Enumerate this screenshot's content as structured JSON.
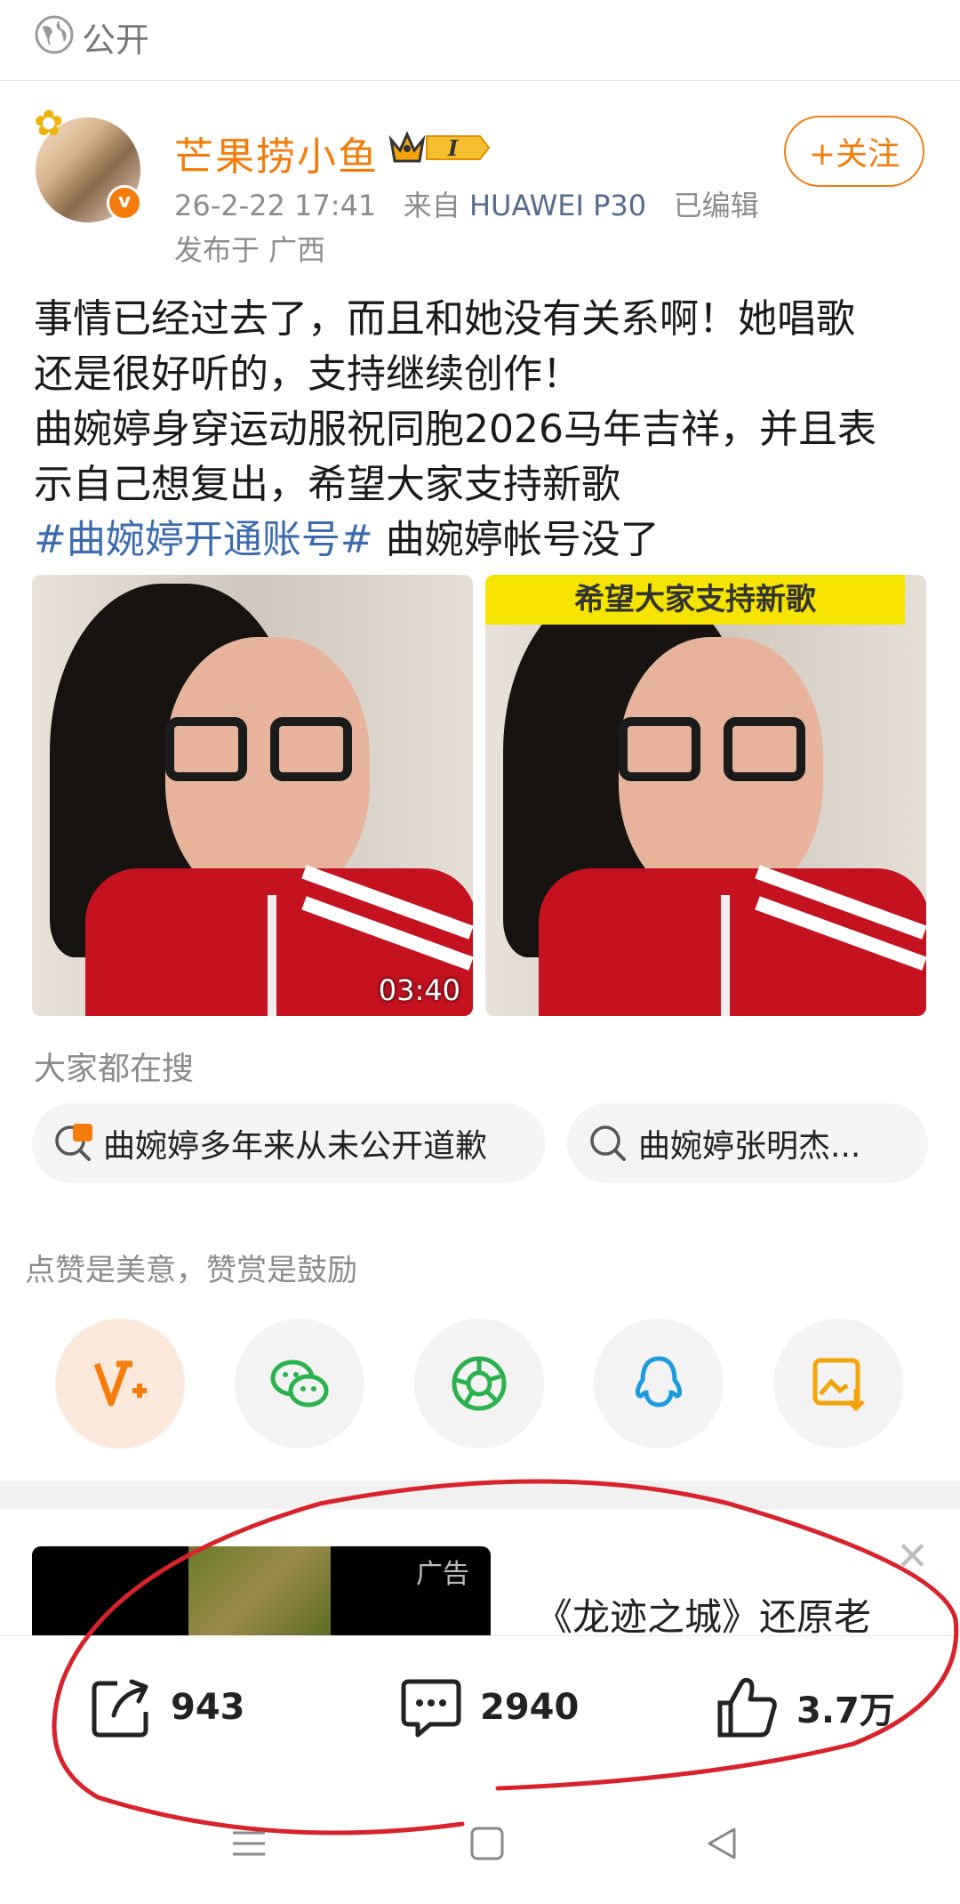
{
  "visibility": {
    "label": "公开",
    "icon": "globe-icon"
  },
  "post": {
    "username": "芒果捞小鱼",
    "level_badge": "I",
    "meta_time": "26-2-22 17:41",
    "meta_from_prefix": "来自",
    "meta_device": "HUAWEI P30",
    "meta_edited": "已编辑",
    "location": "发布于 广西",
    "follow_label": "+关注",
    "body_lines": [
      "事情已经过去了，而且和她没有关系啊！她唱歌",
      "还是很好听的，支持继续创作！",
      "曲婉婷身穿运动服祝同胞2026马年吉祥，并且表",
      "示自己想复出，希望大家支持新歌"
    ],
    "hashtag": "#曲婉婷开通账号#",
    "hashtag_after": " 曲婉婷帐号没了",
    "video_duration": "03:40",
    "image2_banner": "希望大家支持新歌"
  },
  "search": {
    "title": "大家都在搜",
    "items": [
      {
        "label": "曲婉婷多年来从未公开道歉",
        "icon": "hot-search-icon"
      },
      {
        "label": "曲婉婷张明杰...",
        "icon": "search-icon"
      }
    ]
  },
  "reward_text": "点赞是美意，赞赏是鼓励",
  "share_buttons": [
    {
      "name": "reward-button",
      "icon": "v-plus-icon"
    },
    {
      "name": "wechat-button",
      "icon": "wechat-icon"
    },
    {
      "name": "moments-button",
      "icon": "moments-icon"
    },
    {
      "name": "qq-button",
      "icon": "qq-icon"
    },
    {
      "name": "save-image-button",
      "icon": "save-image-icon"
    }
  ],
  "ad": {
    "tag": "广告",
    "title": "《龙迹之城》还原老"
  },
  "actions": {
    "repost": "943",
    "comment": "2940",
    "like": "3.7万"
  },
  "colors": {
    "accent": "#f57c0a",
    "link": "#3b6bb0",
    "annotation": "#d8232a"
  }
}
